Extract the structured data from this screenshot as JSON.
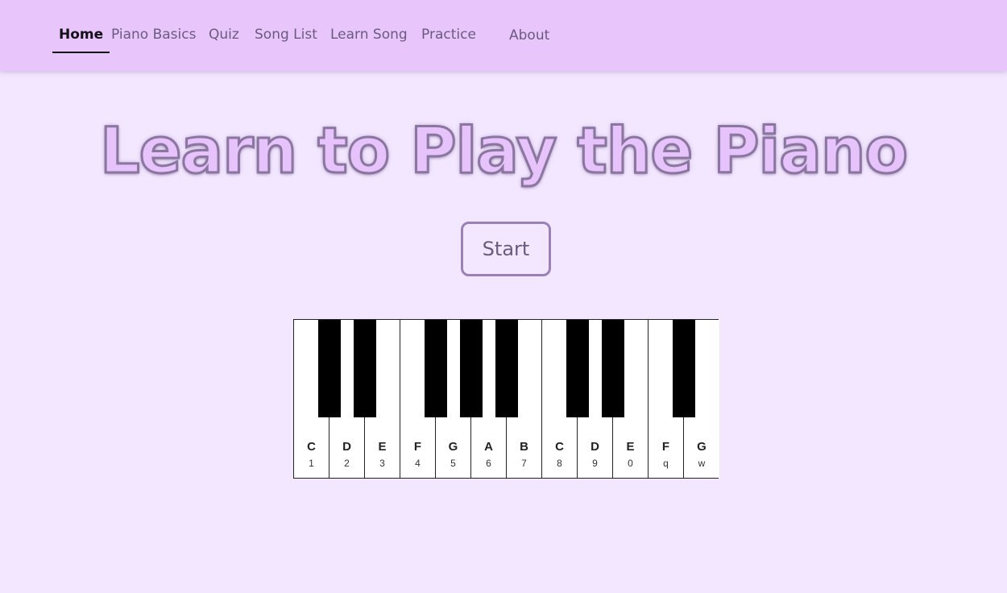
{
  "nav": {
    "items": [
      {
        "label": "Home",
        "active": true
      },
      {
        "label": "Piano Basics",
        "active": false
      },
      {
        "label": "Quiz",
        "active": false
      },
      {
        "label": "Song List",
        "active": false
      },
      {
        "label": "Learn Song",
        "active": false
      },
      {
        "label": "Practice",
        "active": false
      },
      {
        "label": "About",
        "active": false
      }
    ]
  },
  "hero": {
    "title": "Learn to Play the Piano",
    "start_label": "Start"
  },
  "piano": {
    "white_keys": [
      {
        "note": "C",
        "key": "1"
      },
      {
        "note": "D",
        "key": "2"
      },
      {
        "note": "E",
        "key": "3"
      },
      {
        "note": "F",
        "key": "4"
      },
      {
        "note": "G",
        "key": "5"
      },
      {
        "note": "A",
        "key": "6"
      },
      {
        "note": "B",
        "key": "7"
      },
      {
        "note": "C",
        "key": "8"
      },
      {
        "note": "D",
        "key": "9"
      },
      {
        "note": "E",
        "key": "0"
      },
      {
        "note": "F",
        "key": "q"
      },
      {
        "note": "G",
        "key": "w"
      }
    ]
  },
  "colors": {
    "nav_bg": "#e8c6fb",
    "page_bg": "#f3e6ff",
    "title_fill": "#e6c4fb",
    "title_outline": "#8a76a0",
    "accent": "#9a82b6"
  }
}
